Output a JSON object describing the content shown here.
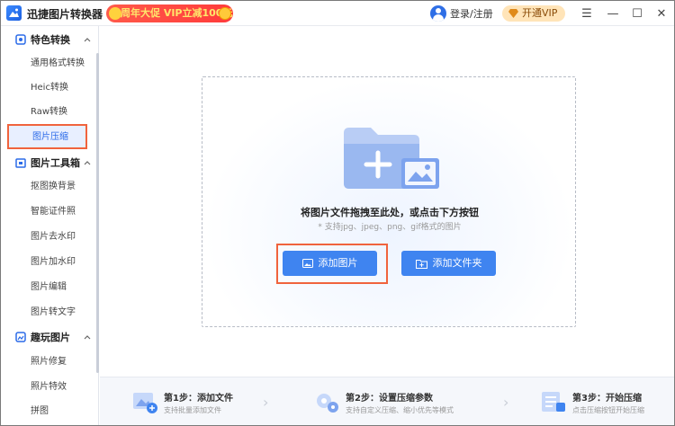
{
  "app": {
    "title": "迅捷图片转换器",
    "promo_text": "周年大促 VIP立减100元",
    "login_text": "登录/注册",
    "vip_label": "开通VIP",
    "controls": {
      "menu": "☰",
      "minimize": "—",
      "maximize": "☐",
      "close": "✕"
    }
  },
  "sidebar": {
    "sections": [
      {
        "label": "特色转换",
        "icon": "badge-icon",
        "items": [
          "通用格式转换",
          "Heic转换",
          "Raw转换",
          "图片压缩"
        ]
      },
      {
        "label": "图片工具箱",
        "icon": "toolbox-icon",
        "items": [
          "抠图换背景",
          "智能证件照",
          "图片去水印",
          "图片加水印",
          "图片编辑",
          "图片转文字"
        ]
      },
      {
        "label": "趣玩图片",
        "icon": "fun-image-icon",
        "items": [
          "照片修复",
          "照片特效",
          "拼图"
        ]
      }
    ],
    "active_item": "图片压缩"
  },
  "dropzone": {
    "title": "将图片文件拖拽至此处，或点击下方按钮",
    "subtitle": "* 支持jpg、jpeg、png、gif格式的图片",
    "add_image_label": "添加图片",
    "add_folder_label": "添加文件夹"
  },
  "steps": [
    {
      "title": "第1步：添加文件",
      "desc": "支持批量添加文件",
      "icon": "image-upload-icon"
    },
    {
      "title": "第2步：设置压缩参数",
      "desc": "支持自定义压缩、缩小优先等模式",
      "icon": "settings-gears-icon"
    },
    {
      "title": "第3步：开始压缩",
      "desc": "点击压缩按钮开始压缩",
      "icon": "compress-list-icon"
    }
  ],
  "colors": {
    "accent": "#3f84f0",
    "active_bg": "#e8efff",
    "highlight_outline": "#f0633d",
    "promo_bg": "#ff4a3f",
    "vip_bg": "#ffe4b8"
  }
}
